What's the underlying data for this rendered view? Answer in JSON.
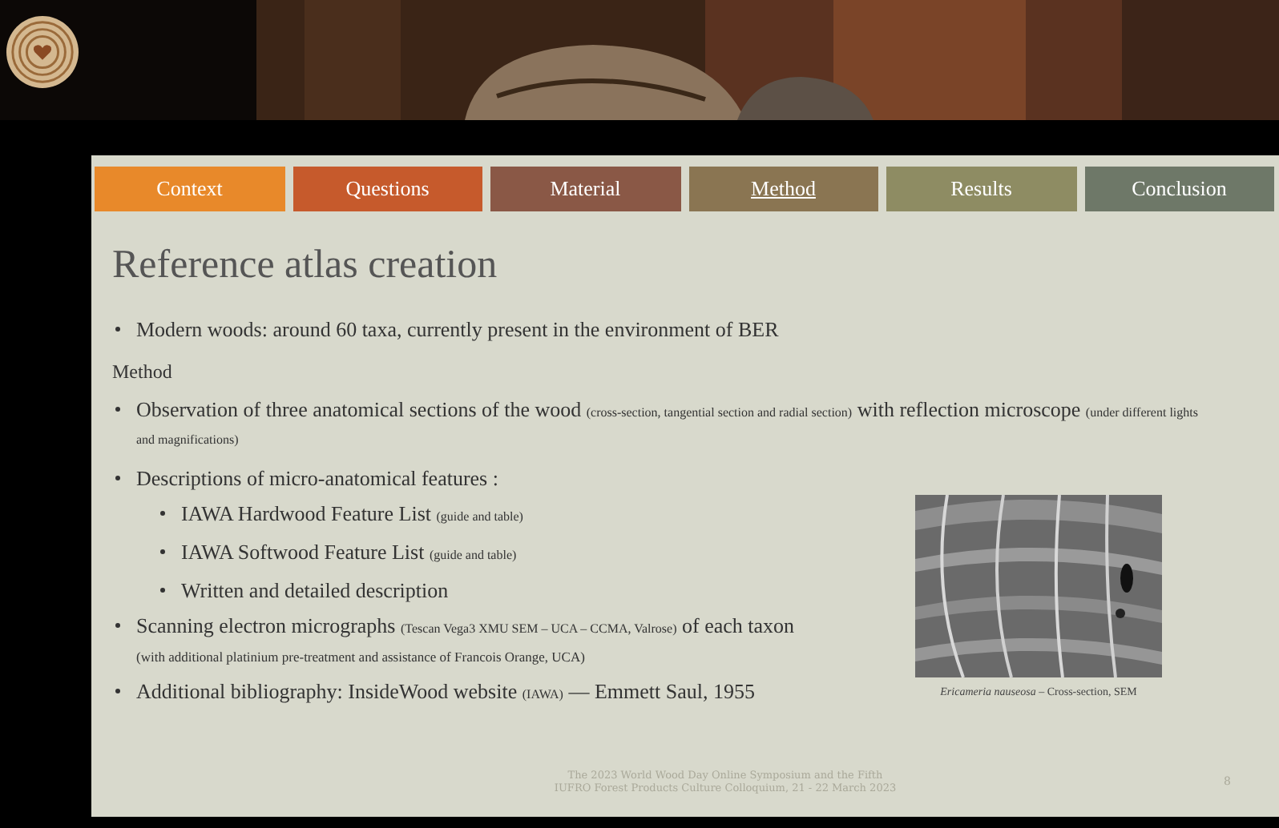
{
  "tabs": [
    {
      "label": "Context",
      "selected": false,
      "color": "#e8892a"
    },
    {
      "label": "Questions",
      "selected": false,
      "color": "#c65a2c"
    },
    {
      "label": "Material",
      "selected": false,
      "color": "#8a5846"
    },
    {
      "label": "Method",
      "selected": true,
      "color": "#8a7552"
    },
    {
      "label": "Results",
      "selected": false,
      "color": "#8e8c63"
    },
    {
      "label": "Conclusion",
      "selected": false,
      "color": "#6e7868"
    }
  ],
  "title": "Reference atlas creation",
  "intro": [
    {
      "parts": [
        {
          "text": "Modern woods: around 60 taxa, currently present in the environment of BER",
          "small": false
        }
      ]
    }
  ],
  "section_label": "Method",
  "items": [
    {
      "parts": [
        {
          "text": "Observation of three anatomical sections of the wood",
          "small": false
        },
        {
          "text": "(cross-section, tangential section and radial section)",
          "small": true
        },
        {
          "text": "with reflection microscope",
          "small": false
        },
        {
          "text": "(under different lights and magnifications)",
          "small": true
        }
      ]
    },
    {
      "parts": [
        {
          "text": "Descriptions of micro-anatomical features :",
          "small": false
        }
      ],
      "children": [
        {
          "parts": [
            {
              "text": "IAWA Hardwood Feature List",
              "small": false
            },
            {
              "text": "(guide and table)",
              "small": true
            }
          ]
        },
        {
          "parts": [
            {
              "text": "IAWA Softwood Feature List",
              "small": false
            },
            {
              "text": "(guide and table)",
              "small": true
            }
          ]
        },
        {
          "parts": [
            {
              "text": "Written and detailed description",
              "small": false
            }
          ]
        }
      ]
    },
    {
      "parts": [
        {
          "text": "Scanning electron micrographs",
          "small": false
        },
        {
          "text": "(Tescan Vega3 XMU SEM – UCA – CCMA, Valrose)",
          "small": true
        },
        {
          "text": "of each taxon",
          "small": false
        }
      ],
      "note": "(with additional platinium pre-treatment and assistance of Francois Orange, UCA)"
    },
    {
      "parts": [
        {
          "text": "Additional bibliography: InsideWood website",
          "small": false
        },
        {
          "text": "(IAWA)",
          "small": true
        },
        {
          "text": "— Emmett Saul, 1955",
          "small": false
        }
      ]
    }
  ],
  "figure": {
    "kind": "picture",
    "caption": "*Ericameria nauseosa* – Cross-section, SEM"
  },
  "footer": "The 2023 World Wood Day Online Symposium and the Fifth IUFRO Forest Products Culture Colloquium, 21 - 22 March 2023",
  "page_number": "8"
}
